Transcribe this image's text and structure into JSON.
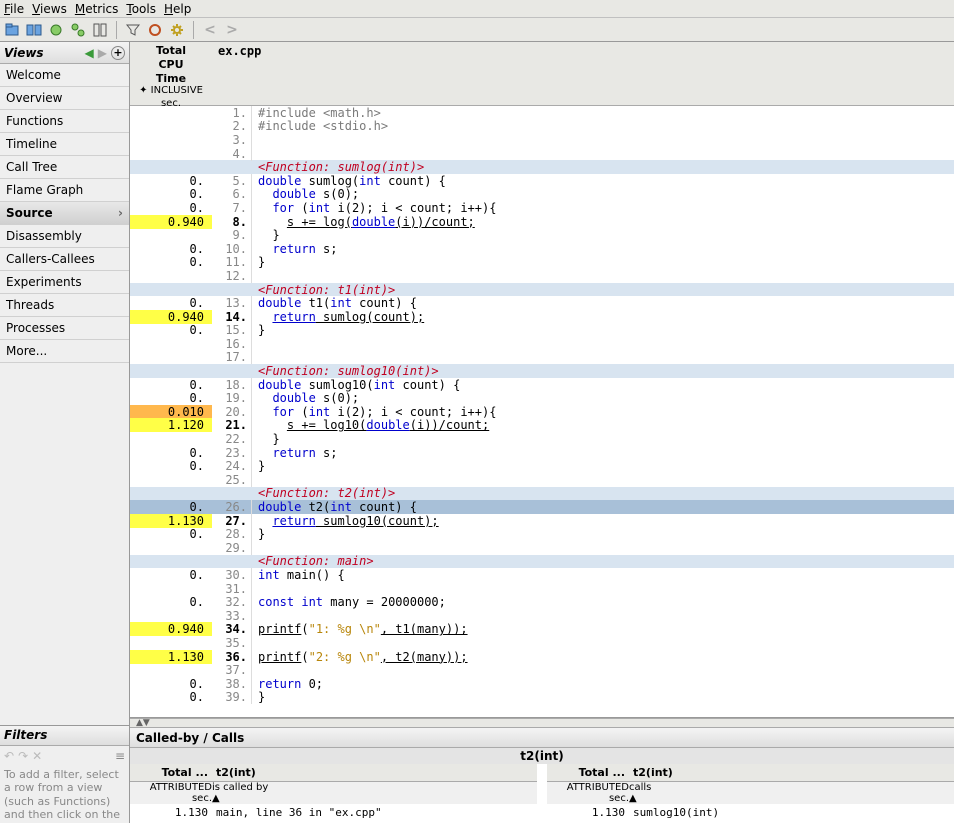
{
  "menu": {
    "file": "File",
    "views": "Views",
    "metrics": "Metrics",
    "tools": "Tools",
    "help": "Help"
  },
  "sidebar": {
    "header": "Views",
    "items": [
      "Welcome",
      "Overview",
      "Functions",
      "Timeline",
      "Call Tree",
      "Flame Graph",
      "Source",
      "Disassembly",
      "Callers-Callees",
      "Experiments",
      "Threads",
      "Processes",
      "More..."
    ],
    "selected": 6
  },
  "filters": {
    "header": "Filters",
    "hint": "To add a filter, select a row from a view (such as Functions) and then click on the"
  },
  "source": {
    "metric_header": {
      "l1": "Total",
      "l2": "CPU",
      "l3": "Time",
      "sub1": "INCLUSIVE",
      "sub2": "sec."
    },
    "file": "ex.cpp",
    "rows": [
      {
        "m": "",
        "n": "1.",
        "tokens": [
          {
            "t": "#include ",
            "c": "pre"
          },
          {
            "t": "<math.h>",
            "c": "inc"
          }
        ]
      },
      {
        "m": "",
        "n": "2.",
        "tokens": [
          {
            "t": "#include ",
            "c": "pre"
          },
          {
            "t": "<stdio.h>",
            "c": "inc"
          }
        ]
      },
      {
        "m": "",
        "n": "3.",
        "tokens": []
      },
      {
        "m": "",
        "n": "4.",
        "tokens": []
      },
      {
        "m": "",
        "n": "",
        "func": true,
        "tokens": [
          {
            "t": "<Function: sumlog(int)>",
            "c": "fn-tag"
          }
        ]
      },
      {
        "m": "0.",
        "n": "5.",
        "tokens": [
          {
            "t": "double",
            "c": "kw"
          },
          {
            "t": " sumlog("
          },
          {
            "t": "int",
            "c": "kw"
          },
          {
            "t": " count) {"
          }
        ]
      },
      {
        "m": "0.",
        "n": "6.",
        "tokens": [
          {
            "t": "  "
          },
          {
            "t": "double",
            "c": "kw"
          },
          {
            "t": " s(0);"
          }
        ]
      },
      {
        "m": "0.",
        "n": "7.",
        "tokens": [
          {
            "t": "  "
          },
          {
            "t": "for",
            "c": "kw"
          },
          {
            "t": " ("
          },
          {
            "t": "int",
            "c": "kw"
          },
          {
            "t": " i(2); i < count; i++){"
          }
        ]
      },
      {
        "m": "0.940",
        "n": "8.",
        "hl": "y",
        "hot": true,
        "tokens": [
          {
            "t": "    "
          },
          {
            "t": "s += log(",
            "c": "und"
          },
          {
            "t": "double",
            "c": "kw und"
          },
          {
            "t": "(i))/count;",
            "c": "und"
          }
        ]
      },
      {
        "m": "",
        "n": "9.",
        "tokens": [
          {
            "t": "  }"
          }
        ]
      },
      {
        "m": "0.",
        "n": "10.",
        "tokens": [
          {
            "t": "  "
          },
          {
            "t": "return",
            "c": "kw"
          },
          {
            "t": " s;"
          }
        ]
      },
      {
        "m": "0.",
        "n": "11.",
        "tokens": [
          {
            "t": "}"
          }
        ]
      },
      {
        "m": "",
        "n": "12.",
        "tokens": []
      },
      {
        "m": "",
        "n": "",
        "func": true,
        "tokens": [
          {
            "t": "<Function: t1(int)>",
            "c": "fn-tag"
          }
        ]
      },
      {
        "m": "0.",
        "n": "13.",
        "tokens": [
          {
            "t": "double",
            "c": "kw"
          },
          {
            "t": " t1("
          },
          {
            "t": "int",
            "c": "kw"
          },
          {
            "t": " count) {"
          }
        ]
      },
      {
        "m": "0.940",
        "n": "14.",
        "hl": "y",
        "hot": true,
        "tokens": [
          {
            "t": "  "
          },
          {
            "t": "return",
            "c": "kw und"
          },
          {
            "t": " sumlog(count);",
            "c": "und"
          }
        ]
      },
      {
        "m": "0.",
        "n": "15.",
        "tokens": [
          {
            "t": "}"
          }
        ]
      },
      {
        "m": "",
        "n": "16.",
        "tokens": []
      },
      {
        "m": "",
        "n": "17.",
        "tokens": []
      },
      {
        "m": "",
        "n": "",
        "func": true,
        "tokens": [
          {
            "t": "<Function: sumlog10(int)>",
            "c": "fn-tag"
          }
        ]
      },
      {
        "m": "0.",
        "n": "18.",
        "tokens": [
          {
            "t": "double",
            "c": "kw"
          },
          {
            "t": " sumlog10("
          },
          {
            "t": "int",
            "c": "kw"
          },
          {
            "t": " count) {"
          }
        ]
      },
      {
        "m": "0.",
        "n": "19.",
        "tokens": [
          {
            "t": "  "
          },
          {
            "t": "double",
            "c": "kw"
          },
          {
            "t": " s(0);"
          }
        ]
      },
      {
        "m": "0.010",
        "n": "20.",
        "hl": "o",
        "tokens": [
          {
            "t": "  "
          },
          {
            "t": "for",
            "c": "kw"
          },
          {
            "t": " ("
          },
          {
            "t": "int",
            "c": "kw"
          },
          {
            "t": " i(2); i < count; i++){"
          }
        ]
      },
      {
        "m": "1.120",
        "n": "21.",
        "hl": "y",
        "hot": true,
        "tokens": [
          {
            "t": "    "
          },
          {
            "t": "s += log10(",
            "c": "und"
          },
          {
            "t": "double",
            "c": "kw und"
          },
          {
            "t": "(i))/count;",
            "c": "und"
          }
        ]
      },
      {
        "m": "",
        "n": "22.",
        "tokens": [
          {
            "t": "  }"
          }
        ]
      },
      {
        "m": "0.",
        "n": "23.",
        "tokens": [
          {
            "t": "  "
          },
          {
            "t": "return",
            "c": "kw"
          },
          {
            "t": " s;"
          }
        ]
      },
      {
        "m": "0.",
        "n": "24.",
        "tokens": [
          {
            "t": "}"
          }
        ]
      },
      {
        "m": "",
        "n": "25.",
        "tokens": []
      },
      {
        "m": "",
        "n": "",
        "func": true,
        "tokens": [
          {
            "t": "<Function: t2(int)>",
            "c": "fn-tag"
          }
        ]
      },
      {
        "m": "0.",
        "n": "26.",
        "sel": true,
        "tokens": [
          {
            "t": "double",
            "c": "kw"
          },
          {
            "t": " t2("
          },
          {
            "t": "int",
            "c": "kw"
          },
          {
            "t": " count) {"
          }
        ]
      },
      {
        "m": "1.130",
        "n": "27.",
        "hl": "y",
        "hot": true,
        "tokens": [
          {
            "t": "  "
          },
          {
            "t": "return",
            "c": "kw und"
          },
          {
            "t": " sumlog10(count);",
            "c": "und"
          }
        ]
      },
      {
        "m": "0.",
        "n": "28.",
        "tokens": [
          {
            "t": "}"
          }
        ]
      },
      {
        "m": "",
        "n": "29.",
        "tokens": []
      },
      {
        "m": "",
        "n": "",
        "func": true,
        "tokens": [
          {
            "t": "<Function: main>",
            "c": "fn-tag"
          }
        ]
      },
      {
        "m": "0.",
        "n": "30.",
        "tokens": [
          {
            "t": "int",
            "c": "kw"
          },
          {
            "t": " main() {"
          }
        ]
      },
      {
        "m": "",
        "n": "31.",
        "tokens": []
      },
      {
        "m": "0.",
        "n": "32.",
        "tokens": [
          {
            "t": "const",
            "c": "kw"
          },
          {
            "t": " "
          },
          {
            "t": "int",
            "c": "kw"
          },
          {
            "t": " many = 20000000;"
          }
        ]
      },
      {
        "m": "",
        "n": "33.",
        "tokens": []
      },
      {
        "m": "0.940",
        "n": "34.",
        "hl": "y",
        "hot": true,
        "tokens": [
          {
            "t": "printf",
            "c": "und"
          },
          {
            "t": "("
          },
          {
            "t": "\"1: %g \\n\"",
            "c": "str"
          },
          {
            "t": ", t1(many));",
            "c": "und"
          }
        ]
      },
      {
        "m": "",
        "n": "35.",
        "tokens": []
      },
      {
        "m": "1.130",
        "n": "36.",
        "hl": "y",
        "hot": true,
        "tokens": [
          {
            "t": "printf",
            "c": "und"
          },
          {
            "t": "("
          },
          {
            "t": "\"2: %g \\n\"",
            "c": "str"
          },
          {
            "t": ", t2(many));",
            "c": "und"
          }
        ]
      },
      {
        "m": "",
        "n": "37.",
        "tokens": []
      },
      {
        "m": "0.",
        "n": "38.",
        "tokens": [
          {
            "t": "return",
            "c": "kw"
          },
          {
            "t": " 0;"
          }
        ]
      },
      {
        "m": "0.",
        "n": "39.",
        "tokens": [
          {
            "t": "}"
          }
        ]
      }
    ]
  },
  "calls": {
    "tab": "Called-by / Calls",
    "title": "t2(int)",
    "left": {
      "h1": "Total ...",
      "h2": "t2(int)",
      "s1": "ATTRIBUTED",
      "s2": "is called by",
      "s3": "sec.",
      "row_m": "1.130",
      "row_t": "main,  line 36 in \"ex.cpp\""
    },
    "right": {
      "h1": "Total ...",
      "h2": "t2(int)",
      "s1": "ATTRIBUTED",
      "s2": "calls",
      "s3": "sec.",
      "row_m": "1.130",
      "row_t": "sumlog10(int)"
    }
  }
}
